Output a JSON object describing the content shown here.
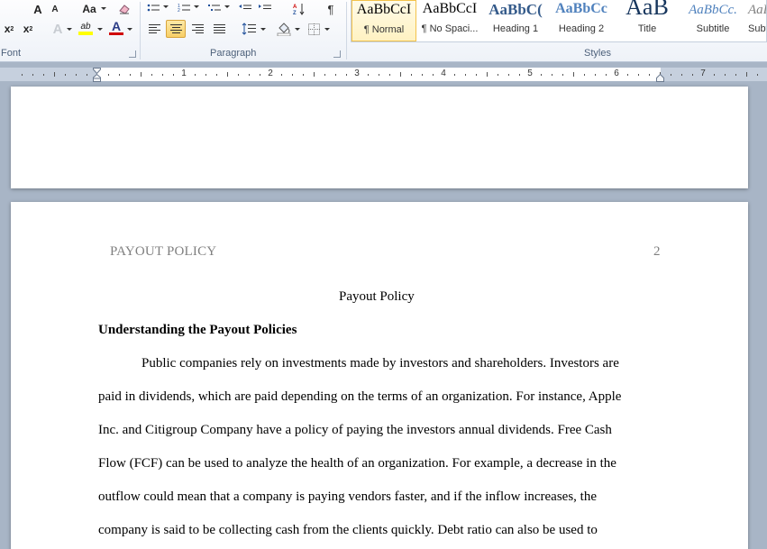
{
  "ribbon": {
    "font_group": {
      "label": "Font",
      "grow_font": "A",
      "shrink_font": "A",
      "change_case": "Aa",
      "subscript": "x",
      "superscript": "x",
      "highlight_text": "ab",
      "font_color_letter": "A",
      "font_color": "#d00000",
      "highlight_color": "#ffff00"
    },
    "paragraph_group": {
      "label": "Paragraph"
    },
    "styles_group": {
      "label": "Styles",
      "tiles": [
        {
          "sample": "AaBbCcI",
          "name": "¶ Normal"
        },
        {
          "sample": "AaBbCcI",
          "name": "¶ No Spaci..."
        },
        {
          "sample": "AaBbC(",
          "name": "Heading 1"
        },
        {
          "sample": "AaBbCc",
          "name": "Heading 2"
        },
        {
          "sample": "AaB",
          "name": "Title"
        },
        {
          "sample": "AaBbCc.",
          "name": "Subtitle"
        },
        {
          "sample": "AaBl",
          "name": "Subt"
        }
      ]
    }
  },
  "ruler": {
    "numbers": [
      "1",
      "2",
      "3",
      "4",
      "5",
      "6",
      "7"
    ]
  },
  "document": {
    "running_head": "PAYOUT POLICY",
    "page_number": "2",
    "title": "Payout Policy",
    "heading": "Understanding the Payout Policies",
    "lines": [
      "Public companies rely on investments made by investors and shareholders. Investors are",
      "paid in dividends, which are paid depending on the terms of an organization. For instance, Apple",
      "Inc. and Citigroup Company have a policy of paying the investors annual dividends. Free Cash",
      "Flow (FCF) can be used to analyze the health of an organization. For example, a decrease in the",
      "outflow could mean that a company is paying vendors faster, and if the inflow increases, the",
      "company is said to be collecting cash from the clients quickly. Debt ratio can also be used to"
    ]
  }
}
